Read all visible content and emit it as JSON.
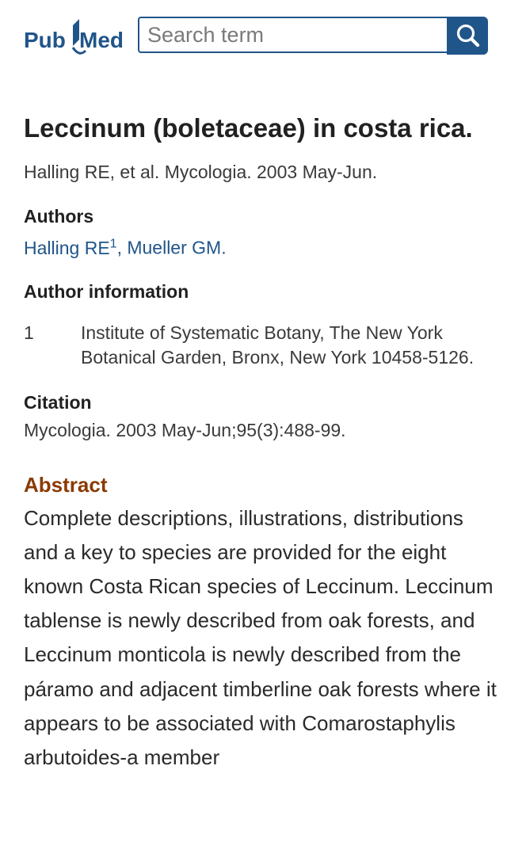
{
  "header": {
    "logo_text_pub": "Pub",
    "logo_text_med": "Med",
    "search_placeholder": "Search term",
    "search_button_icon": "magnifier-icon",
    "colors": {
      "brand": "#20558a",
      "logo_pub": "#20558a",
      "logo_med": "#20558a",
      "abstract_heading": "#8a3a00"
    }
  },
  "article": {
    "title": "Leccinum (boletaceae) in costa rica.",
    "short_citation": "Halling RE, et al. Mycologia. 2003 May-Jun.",
    "authors_heading": "Authors",
    "authors": [
      {
        "name": "Halling RE",
        "affiliation_marker": "1"
      },
      {
        "name": "Mueller GM"
      }
    ],
    "author_separator": ", ",
    "authors_end": ".",
    "author_info_heading": "Author information",
    "affiliations": [
      {
        "number": "1",
        "text": "Institute of Systematic Botany, The New York Botanical Garden, Bronx, New York 10458-5126."
      }
    ],
    "citation_heading": "Citation",
    "citation": "Mycologia. 2003 May-Jun;95(3):488-99.",
    "abstract_heading": "Abstract",
    "abstract": "Complete descriptions, illustrations, distributions and a key to species are provided for the eight known Costa Rican species of Leccinum. Leccinum tablense is newly described from oak forests, and Leccinum monticola is newly described from the páramo and adjacent timberline oak forests where it appears to be associated with Comarostaphylis arbutoides-a member"
  }
}
